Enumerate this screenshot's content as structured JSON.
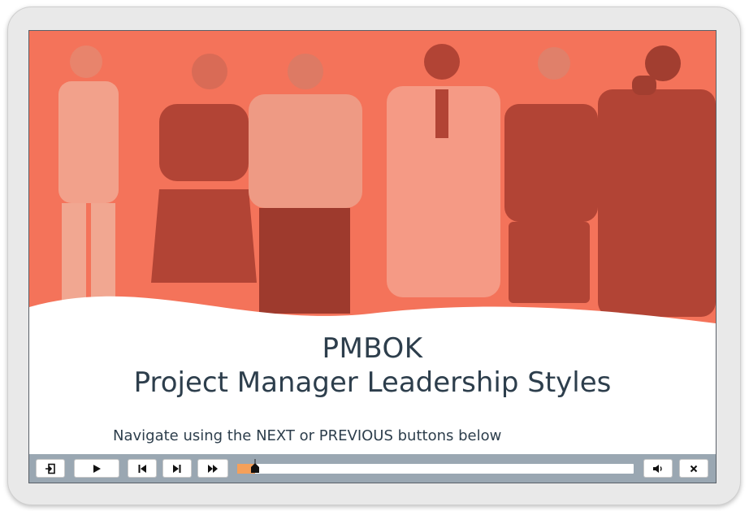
{
  "slide": {
    "title_line1": "PMBOK",
    "title_line2": "Project Manager Leadership Styles",
    "nav_hint": "Navigate using the NEXT or PREVIOUS buttons below",
    "hero_tint": "#f4735a"
  },
  "controls": {
    "exit_icon": "exit-icon",
    "play_icon": "play-icon",
    "rewind_icon": "skip-to-start-icon",
    "next_icon": "next-slide-icon",
    "fastforward_icon": "fast-forward-icon",
    "volume_icon": "volume-icon",
    "close_icon": "close-icon",
    "progress_fraction": 0.045,
    "accent": "#f5a05a",
    "bar_color": "#9aa7b2"
  }
}
